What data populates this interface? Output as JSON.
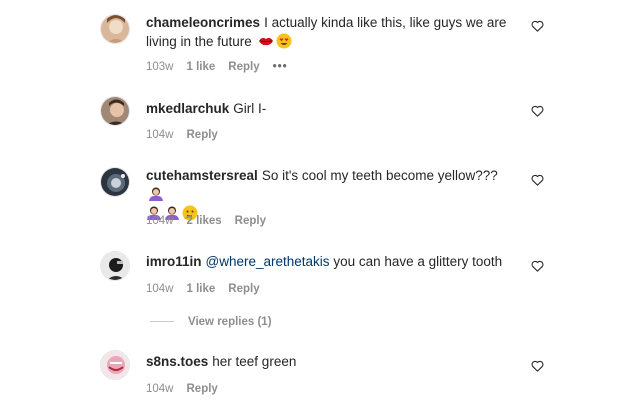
{
  "comments": [
    {
      "username": "chameleoncrimes",
      "text": "I actually kinda like this, like guys we are living in the future",
      "emojis": [
        "lips-emoji",
        "heart-eyes-emoji"
      ],
      "time": "103w",
      "likes": "1 like",
      "reply": "Reply",
      "more": "•••"
    },
    {
      "username": "mkedlarchuk",
      "text": "Girl I-",
      "time": "104w",
      "reply": "Reply"
    },
    {
      "username": "cutehamstersreal",
      "text": "So it's cool my teeth become yellow???",
      "emojis": [
        "woman-shrugging-emoji",
        "woman-shrugging-emoji",
        "woman-shrugging-emoji",
        "thinking-face-emoji"
      ],
      "time": "104w",
      "likes": "2 likes",
      "reply": "Reply"
    },
    {
      "username": "imro11in",
      "mention": "@where_arethetakis",
      "text": " you can have a glittery tooth",
      "time": "104w",
      "likes": "1 like",
      "reply": "Reply",
      "view_replies": "View replies (1)"
    },
    {
      "username": "s8ns.toes",
      "text": "her teef green",
      "time": "104w",
      "reply": "Reply"
    }
  ],
  "icons": {
    "like": "heart-outline-icon"
  },
  "colors": {
    "text": "#262626",
    "muted": "#8e8e8e",
    "mention": "#00376b"
  }
}
